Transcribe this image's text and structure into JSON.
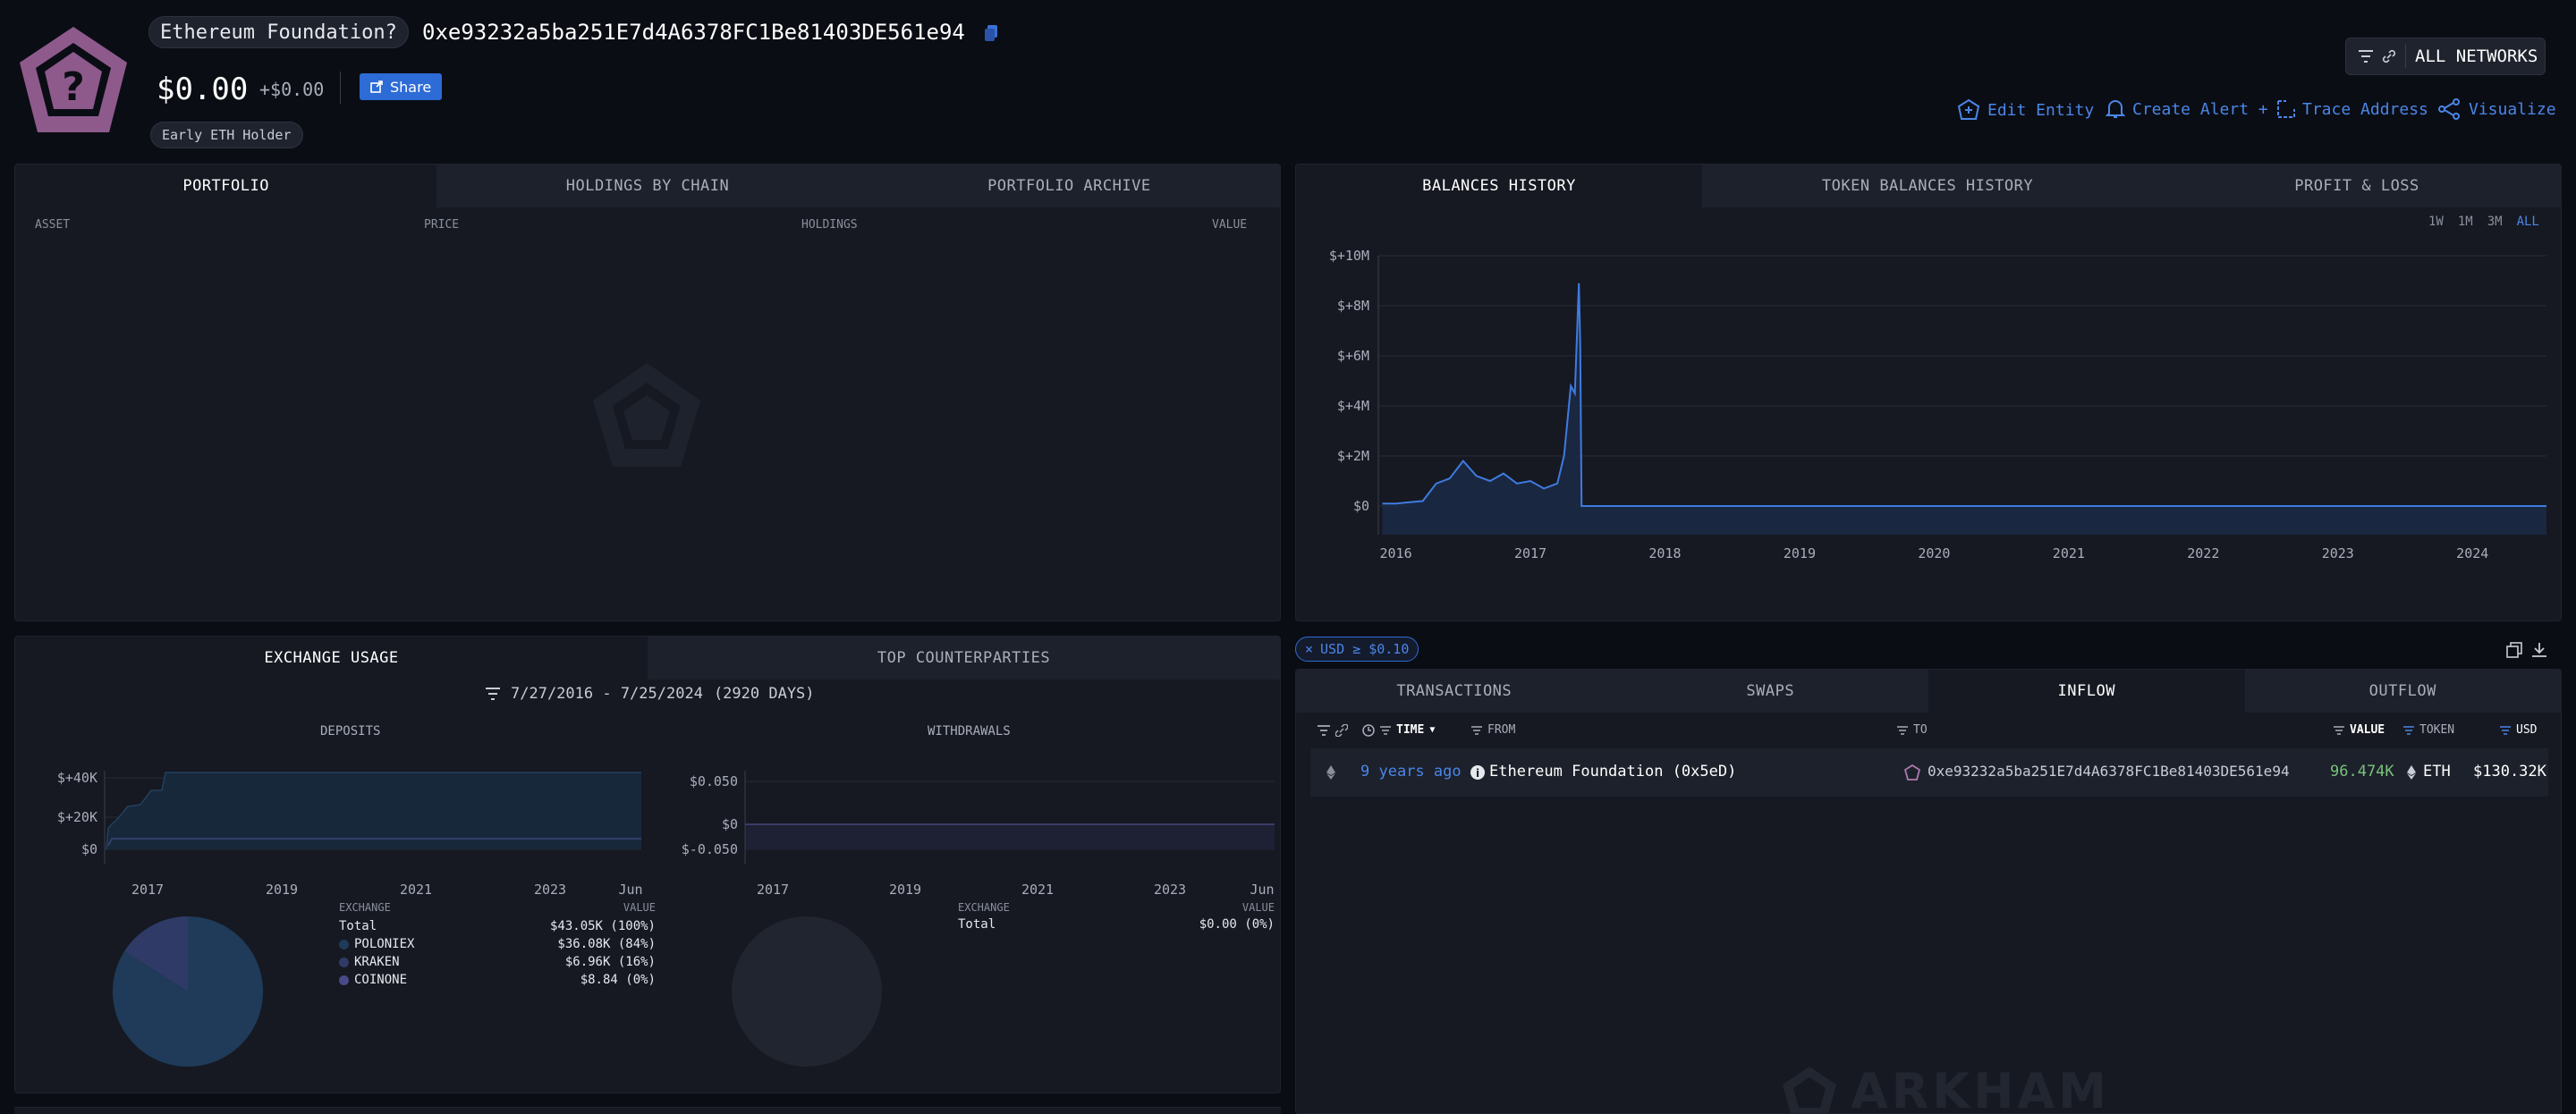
{
  "header": {
    "entity_name": "Ethereum Foundation?",
    "address": "0xe93232a5ba251E7d4A6378FC1Be81403DE561e94",
    "balance": "$0.00",
    "change": "+$0.00",
    "share_label": "Share",
    "tag": "Early ETH Holder",
    "networks_label": "ALL NETWORKS",
    "actions": {
      "edit": "Edit Entity",
      "alert": "Create Alert +",
      "trace": "Trace Address",
      "visualize": "Visualize"
    }
  },
  "portfolio": {
    "tabs": [
      "PORTFOLIO",
      "HOLDINGS BY CHAIN",
      "PORTFOLIO ARCHIVE"
    ],
    "columns": [
      "ASSET",
      "PRICE",
      "HOLDINGS",
      "VALUE"
    ]
  },
  "balances": {
    "tabs": [
      "BALANCES HISTORY",
      "TOKEN BALANCES HISTORY",
      "PROFIT & LOSS"
    ],
    "ranges": [
      "1W",
      "1M",
      "3M",
      "ALL"
    ]
  },
  "exchange": {
    "tabs": [
      "EXCHANGE USAGE",
      "TOP COUNTERPARTIES"
    ],
    "date_range": "7/27/2016 - 7/25/2024",
    "days": "(2920 DAYS)",
    "deposits_title": "DEPOSITS",
    "withdrawals_title": "WITHDRAWALS",
    "deposits_yticks": [
      "$+40K",
      "$+20K",
      "$0"
    ],
    "deposits_xticks": [
      "2017",
      "2019",
      "2021",
      "2023",
      "Jun"
    ],
    "withdrawals_yticks": [
      "$0.050",
      "$0",
      "$-0.050"
    ],
    "withdrawals_xticks": [
      "2017",
      "2019",
      "2021",
      "2023",
      "Jun"
    ],
    "table_headers": [
      "EXCHANGE",
      "VALUE"
    ],
    "deposits_rows": [
      {
        "name": "Total",
        "value": "$43.05K (100%)",
        "color": ""
      },
      {
        "name": "POLONIEX",
        "value": "$36.08K (84%)",
        "color": "#1f3b59"
      },
      {
        "name": "KRAKEN",
        "value": "$6.96K (16%)",
        "color": "#2f3a66"
      },
      {
        "name": "COINONE",
        "value": "$8.84 (0%)",
        "color": "#4a4a8a"
      }
    ],
    "withdrawals_rows": [
      {
        "name": "Total",
        "value": "$0.00 (0%)"
      }
    ]
  },
  "filter": {
    "chip": "USD ≥ $0.10"
  },
  "transactions": {
    "tabs": [
      "TRANSACTIONS",
      "SWAPS",
      "INFLOW",
      "OUTFLOW"
    ],
    "columns": {
      "time": "TIME",
      "from": "FROM",
      "to": "TO",
      "value": "VALUE",
      "token": "TOKEN",
      "usd": "USD"
    },
    "rows": [
      {
        "time": "9 years ago",
        "from": "Ethereum Foundation (0x5eD)",
        "to": "0xe93232a5ba251E7d4A6378FC1Be81403DE561e94",
        "value": "96.474K",
        "token": "ETH",
        "usd": "$130.32K"
      }
    ]
  },
  "watermark": "ARKHAM",
  "chart_data": [
    {
      "type": "area",
      "title": "",
      "yticks": [
        "$+10M",
        "$+8M",
        "$+6M",
        "$+4M",
        "$+2M",
        "$0"
      ],
      "xticks": [
        "2016",
        "2017",
        "2018",
        "2019",
        "2020",
        "2021",
        "2022",
        "2023",
        "2024"
      ],
      "ylim": [
        0,
        10000000
      ],
      "series": [
        {
          "x": [
            2015.9,
            2016.0,
            2016.1,
            2016.2,
            2016.3,
            2016.4,
            2016.5,
            2016.6,
            2016.7,
            2016.8,
            2016.9,
            2017.0,
            2017.1,
            2017.2,
            2017.25,
            2017.3,
            2017.33,
            2017.36,
            2017.37,
            2017.38,
            2017.5,
            2018.0,
            2019.0,
            2020.0,
            2021.0,
            2022.0,
            2023.0,
            2024.0,
            2024.55
          ],
          "y": [
            100000,
            100000,
            150000,
            200000,
            900000,
            1100000,
            1800000,
            1200000,
            1000000,
            1300000,
            900000,
            1000000,
            700000,
            900000,
            2000000,
            4800000,
            4500000,
            8900000,
            6500000,
            0,
            0,
            0,
            0,
            0,
            0,
            0,
            0,
            0,
            0
          ]
        }
      ]
    },
    {
      "type": "pie",
      "title": "DEPOSITS",
      "labels": [
        "POLONIEX",
        "KRAKEN",
        "COINONE"
      ],
      "values": [
        84,
        16,
        0
      ]
    }
  ]
}
